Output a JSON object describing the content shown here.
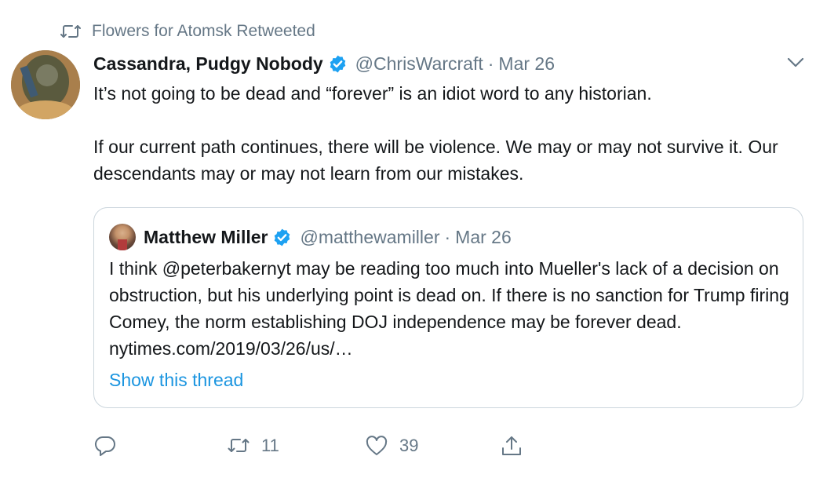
{
  "retweet_banner": {
    "icon": "retweet-icon",
    "text": "Flowers for Atomsk Retweeted"
  },
  "tweet": {
    "avatar": "user-avatar",
    "display_name": "Cassandra, Pudgy Nobody",
    "verified": true,
    "handle": "@ChrisWarcraft",
    "separator": "·",
    "date": "Mar 26",
    "menu_icon": "chevron-down-icon",
    "paragraphs": [
      "It’s not going to be dead and “forever” is an idiot word to any historian.",
      "If our current path continues, there will be violence. We may or may not survive it. Our descendants may or may not learn from our mistakes."
    ]
  },
  "quote": {
    "display_name": "Matthew Miller",
    "verified": true,
    "handle": "@matthewamiller",
    "separator": "·",
    "date": "Mar 26",
    "text": "I think @peterbakernyt may be reading too much into Mueller's lack of a decision on obstruction, but his underlying point is dead on. If there is no sanction for Trump firing Comey, the norm establishing DOJ independence may be forever dead. nytimes.com/2019/03/26/us/…",
    "show_thread": "Show this thread"
  },
  "actions": {
    "reply": {
      "icon": "reply-icon",
      "count": ""
    },
    "retweet": {
      "icon": "retweet-icon",
      "count": "11"
    },
    "like": {
      "icon": "heart-icon",
      "count": "39"
    },
    "share": {
      "icon": "share-icon",
      "count": ""
    }
  },
  "colors": {
    "text": "#14171a",
    "muted": "#657786",
    "link": "#1b95e0",
    "verified": "#1da1f2",
    "border": "#ccd6dd"
  }
}
